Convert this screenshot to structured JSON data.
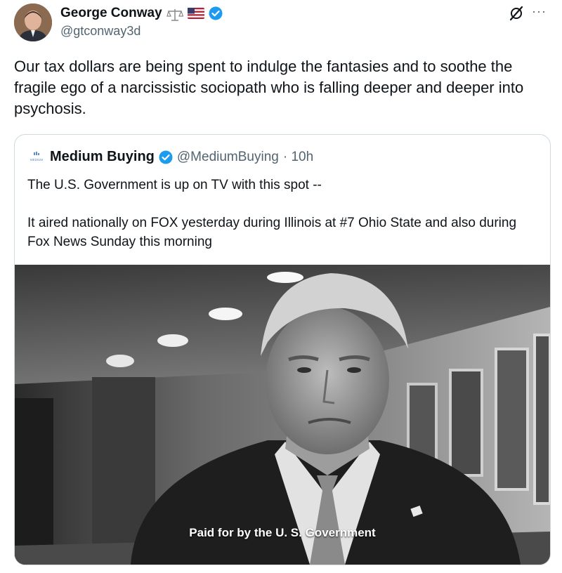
{
  "author": {
    "display_name": "George Conway",
    "handle": "@gtconway3d",
    "badges": [
      "scales-icon",
      "us-flag-icon",
      "verified-icon"
    ]
  },
  "tweet": {
    "text": "Our tax dollars are being spent to indulge the fantasies and to soothe the fragile ego of a narcissistic sociopath who is falling deeper and deeper into psychosis."
  },
  "actions": {
    "more_label": "···"
  },
  "quote": {
    "author_name": "Medium Buying",
    "author_handle": "@MediumBuying",
    "time_meta": "· 10h",
    "logo_text": "MEDIUM",
    "text_line1": "The U.S. Government is up on TV with this spot --",
    "text_line2": "It aired nationally on FOX yesterday during Illinois at #7 Ohio State and also during Fox News Sunday this morning",
    "media_caption": "Paid for by the U. S. Government"
  },
  "colors": {
    "text_primary": "#0f1419",
    "text_secondary": "#536471",
    "verified_blue": "#1d9bf0",
    "border": "#cfd9de"
  }
}
